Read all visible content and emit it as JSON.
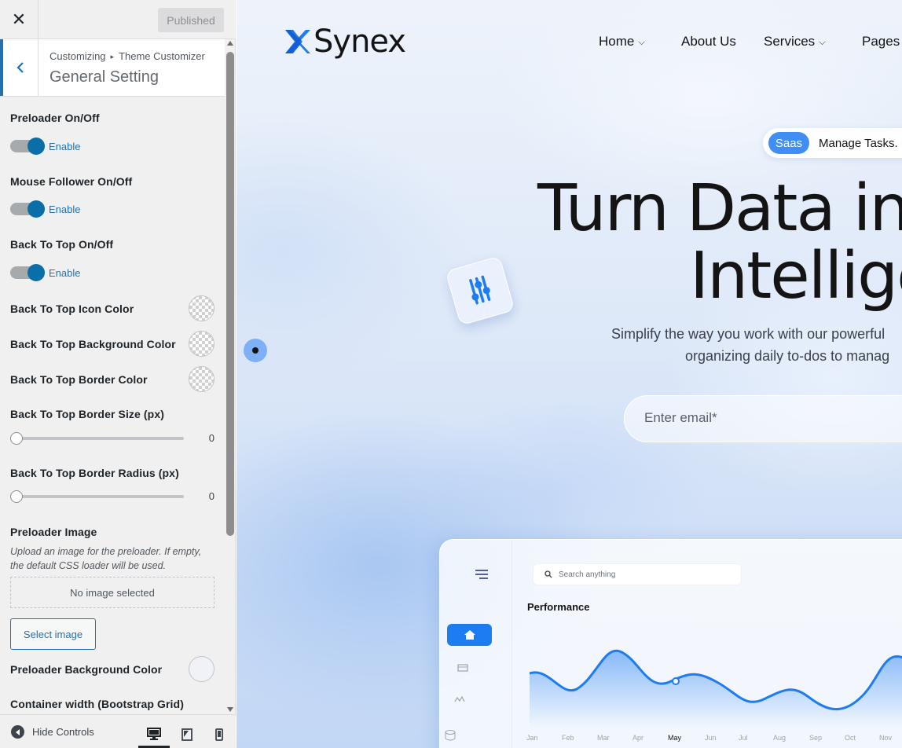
{
  "customizer": {
    "publish_label": "Published",
    "breadcrumb": {
      "root": "Customizing",
      "separator": "▸",
      "current": "Theme Customizer"
    },
    "section_title": "General Setting",
    "controls": {
      "preloader": {
        "label": "Preloader On/Off",
        "state": "Enable"
      },
      "mouse_follower": {
        "label": "Mouse Follower On/Off",
        "state": "Enable"
      },
      "back_to_top": {
        "label": "Back To Top On/Off",
        "state": "Enable"
      },
      "btt_icon_color": {
        "label": "Back To Top Icon Color"
      },
      "btt_bg_color": {
        "label": "Back To Top Background Color"
      },
      "btt_border_color": {
        "label": "Back To Top Border Color"
      },
      "btt_border_size": {
        "label": "Back To Top Border Size (px)",
        "value": "0"
      },
      "btt_border_radius": {
        "label": "Back To Top Border Radius (px)",
        "value": "0"
      },
      "preloader_image": {
        "label": "Preloader Image",
        "description": "Upload an image for the preloader. If empty, the default CSS loader will be used.",
        "empty_text": "No image selected",
        "button": "Select image"
      },
      "preloader_bg_color": {
        "label": "Preloader Background Color"
      },
      "container_width": {
        "label": "Container width (Bootstrap Grid)"
      }
    },
    "footer": {
      "hide_controls": "Hide Controls"
    },
    "colors": {
      "accent": "#2271b1",
      "toggle_on": "#0a6ea8"
    }
  },
  "site": {
    "logo": "Synex",
    "nav": [
      {
        "label": "Home",
        "dropdown": true
      },
      {
        "label": "About Us",
        "dropdown": false
      },
      {
        "label": "Services",
        "dropdown": true
      },
      {
        "label": "Pages",
        "dropdown": false
      }
    ],
    "badge": {
      "tag": "Saas",
      "text": "Manage Tasks. N"
    },
    "hero": {
      "title_line1": "Turn Data into",
      "title_line2": "Intellige",
      "subtitle_line1": "Simplify the way you work with our powerful",
      "subtitle_line2": "organizing daily to-dos to manag"
    },
    "email_placeholder": "Enter email*",
    "dashboard": {
      "search_placeholder": "Search anything",
      "performance_title": "Performance",
      "months": [
        "Jan",
        "Feb",
        "Mar",
        "Apr",
        "May",
        "Jun",
        "Jul",
        "Aug",
        "Sep",
        "Oct",
        "Nov"
      ]
    },
    "colors": {
      "brand": "#1e7cf2",
      "text": "#141414"
    }
  }
}
